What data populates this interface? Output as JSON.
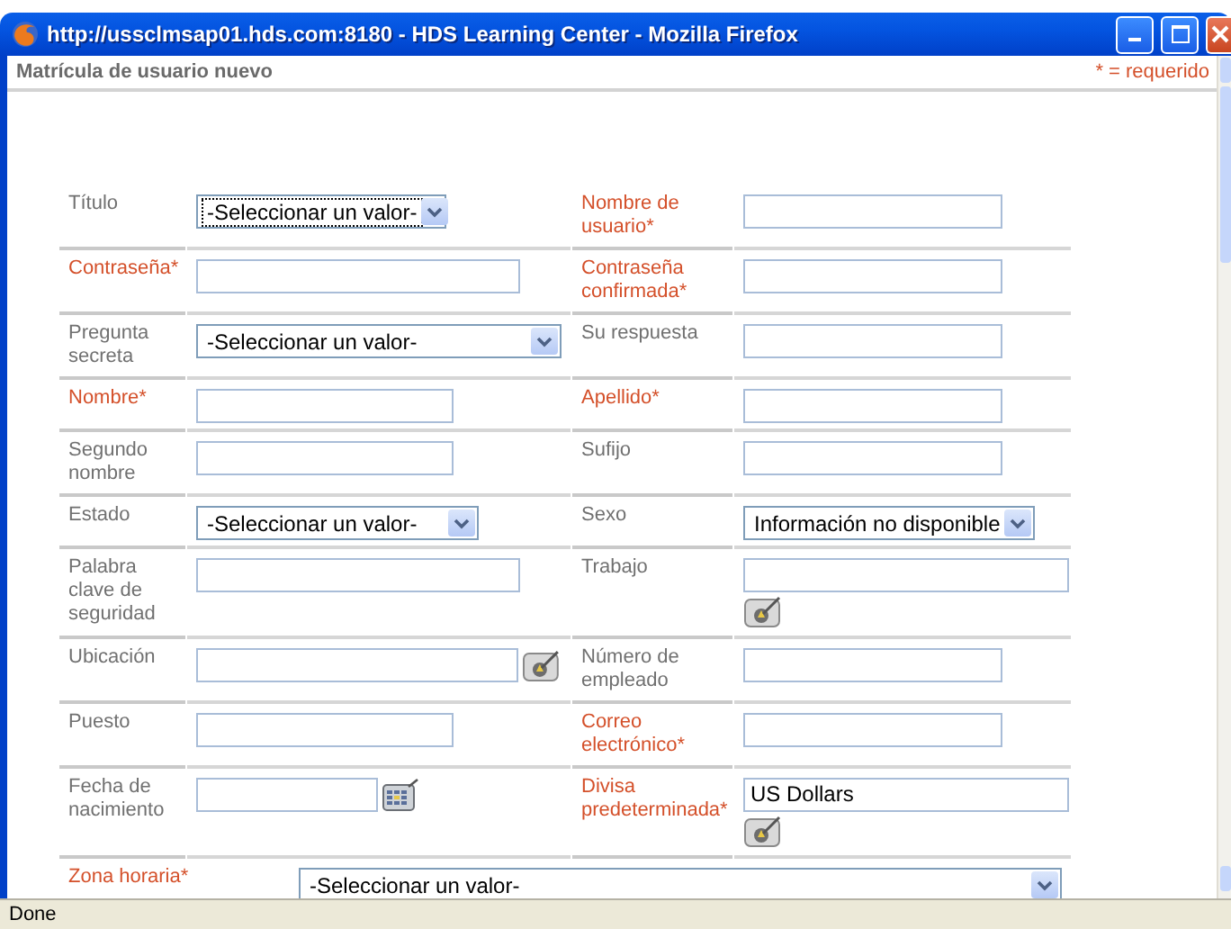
{
  "window": {
    "title": "http://ussclmsap01.hds.com:8180 - HDS Learning Center - Mozilla Firefox"
  },
  "page": {
    "heading": "Matrícula de usuario nuevo",
    "required_note": "* = requerido"
  },
  "rows": [
    {
      "fields": [
        {
          "label": "Título",
          "required": false,
          "control": {
            "kind": "select",
            "value": "-Seleccionar un valor-",
            "focused": true
          }
        },
        {
          "label": "Nombre de usuario*",
          "required": true,
          "control": {
            "kind": "text",
            "focused": false
          }
        }
      ]
    },
    {
      "fields": [
        {
          "label": "Contraseña*",
          "required": true,
          "control": {
            "kind": "text",
            "focused": false
          }
        },
        {
          "label": "Contraseña confirmada*",
          "required": true,
          "control": {
            "kind": "text",
            "focused": false
          }
        }
      ]
    },
    {
      "fields": [
        {
          "label": "Pregunta secreta",
          "required": false,
          "control": {
            "kind": "select",
            "value": "-Seleccionar un valor-",
            "focused": false
          }
        },
        {
          "label": "Su respuesta",
          "required": false,
          "control": {
            "kind": "text",
            "focused": false
          }
        }
      ]
    },
    {
      "fields": [
        {
          "label": "Nombre*",
          "required": true,
          "control": {
            "kind": "text",
            "focused": false
          }
        },
        {
          "label": "Apellido*",
          "required": true,
          "control": {
            "kind": "text",
            "focused": false
          }
        }
      ]
    },
    {
      "fields": [
        {
          "label": "Segundo nombre",
          "required": false,
          "control": {
            "kind": "text",
            "focused": false
          }
        },
        {
          "label": "Sufijo",
          "required": false,
          "control": {
            "kind": "text",
            "focused": false
          }
        }
      ]
    },
    {
      "fields": [
        {
          "label": "Estado",
          "required": false,
          "control": {
            "kind": "select",
            "value": "-Seleccionar un valor-",
            "focused": false
          }
        },
        {
          "label": "Sexo",
          "required": false,
          "control": {
            "kind": "select",
            "value": "Información no disponible",
            "focused": false
          }
        }
      ]
    },
    {
      "fields": [
        {
          "label": "Palabra clave de seguridad",
          "required": false,
          "control": {
            "kind": "text",
            "focused": false
          }
        },
        {
          "label": "Trabajo",
          "required": false,
          "control": {
            "kind": "text",
            "focused": false
          },
          "button": {
            "kind": "picker"
          }
        }
      ]
    },
    {
      "fields": [
        {
          "label": "Ubicación",
          "required": false,
          "control": {
            "kind": "text",
            "focused": false
          },
          "button": {
            "kind": "picker"
          }
        },
        {
          "label": "Número de empleado",
          "required": false,
          "control": {
            "kind": "text",
            "focused": false
          }
        }
      ]
    },
    {
      "fields": [
        {
          "label": "Puesto",
          "required": false,
          "control": {
            "kind": "text",
            "focused": false
          }
        },
        {
          "label": "Correo electrónico*",
          "required": true,
          "control": {
            "kind": "text",
            "focused": false
          }
        }
      ]
    },
    {
      "fields": [
        {
          "label": "Fecha de nacimiento",
          "required": false,
          "control": {
            "kind": "text",
            "focused": false
          },
          "button": {
            "kind": "calendar"
          }
        },
        {
          "label": "Divisa predeterminada*",
          "required": true,
          "control": {
            "kind": "text",
            "value": "US Dollars",
            "focused": false
          },
          "button": {
            "kind": "picker"
          }
        }
      ]
    },
    {
      "fields": [
        {
          "label": "Zona horaria*",
          "required": true,
          "control": {
            "kind": "select",
            "value": "-Seleccionar un valor-",
            "focused": false
          }
        }
      ]
    }
  ],
  "status_bar": "Done"
}
